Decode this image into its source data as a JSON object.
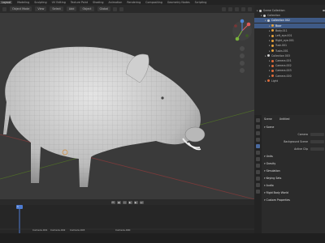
{
  "menubar": {
    "items": [
      "Layout",
      "Modeling",
      "Sculpting",
      "UV Editing",
      "Texture Paint",
      "Shading",
      "Animation",
      "Rendering",
      "Compositing",
      "Geometry Nodes",
      "Scripting"
    ],
    "active_index": 0
  },
  "viewport_header": {
    "mode": "Object Mode",
    "view": "View",
    "select": "Select",
    "add": "Add",
    "object": "Object",
    "transform": "Global",
    "options": "Options"
  },
  "timeline": {
    "markers": [
      "Camera.001",
      "Camera.002",
      "Camera.003",
      "Camera.000"
    ],
    "current_frame": "1",
    "start": "1",
    "end": "250"
  },
  "outliner": {
    "title": "Scene Collection",
    "rows": [
      {
        "label": "Scene Collection",
        "indent": 0,
        "color": "#cfcfcf",
        "selected": false
      },
      {
        "label": "Collection",
        "indent": 1,
        "color": "#cfcfcf",
        "selected": false
      },
      {
        "label": "Collection 002",
        "indent": 2,
        "color": "#cfcfcf",
        "selected": true
      },
      {
        "label": "Boar",
        "indent": 3,
        "color": "#e6a23c",
        "selected": true
      },
      {
        "label": "Body.011",
        "indent": 3,
        "color": "#e6a23c",
        "selected": false
      },
      {
        "label": "Left_eye.001",
        "indent": 3,
        "color": "#e6a23c",
        "selected": false
      },
      {
        "label": "Right_eye.001",
        "indent": 3,
        "color": "#e6a23c",
        "selected": false
      },
      {
        "label": "Tusk.001",
        "indent": 3,
        "color": "#e6a23c",
        "selected": false
      },
      {
        "label": "Tusks.001",
        "indent": 3,
        "color": "#e6a23c",
        "selected": false
      },
      {
        "label": "Collection 003",
        "indent": 2,
        "color": "#cfcfcf",
        "selected": false
      },
      {
        "label": "Camera.001",
        "indent": 3,
        "color": "#e06c3a",
        "selected": false
      },
      {
        "label": "Camera.002",
        "indent": 3,
        "color": "#e06c3a",
        "selected": false
      },
      {
        "label": "Camera.003",
        "indent": 3,
        "color": "#e06c3a",
        "selected": false
      },
      {
        "label": "Camera.000",
        "indent": 3,
        "color": "#e06c3a",
        "selected": false
      },
      {
        "label": "Light",
        "indent": 2,
        "color": "#e06c3a",
        "selected": false
      }
    ]
  },
  "properties": {
    "scene_label": "Scene",
    "scene_name": "Untitled",
    "rows": [
      {
        "label": "Scene",
        "type": "section"
      },
      {
        "label": "Camera",
        "type": "field"
      },
      {
        "label": "Background Scene",
        "type": "field"
      },
      {
        "label": "Active Clip",
        "type": "field"
      },
      {
        "label": "Units",
        "type": "section"
      },
      {
        "label": "Gravity",
        "type": "section"
      },
      {
        "label": "Simulation",
        "type": "section"
      },
      {
        "label": "Keying Sets",
        "type": "section"
      },
      {
        "label": "Audio",
        "type": "section"
      },
      {
        "label": "Rigid Body World",
        "type": "section"
      },
      {
        "label": "Custom Properties",
        "type": "section"
      }
    ]
  },
  "colors": {
    "selection": "#3f5a86",
    "object_orange": "#e6a23c",
    "timeline_cursor": "#4d7bd1"
  }
}
